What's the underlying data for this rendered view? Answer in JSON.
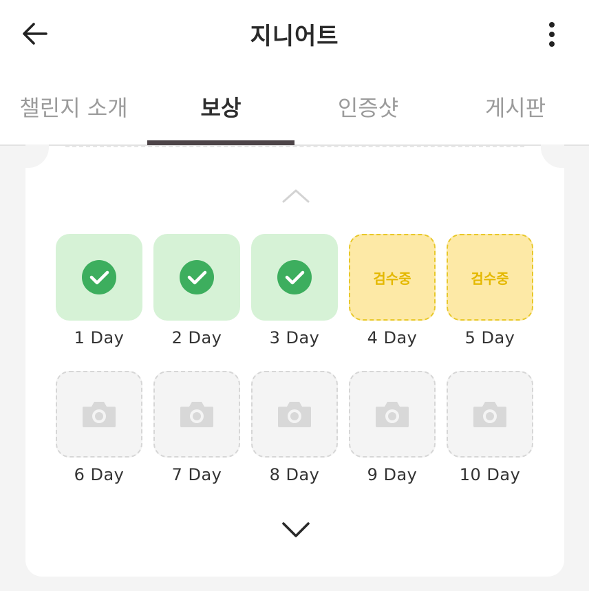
{
  "header": {
    "title": "지니어트",
    "back_icon": "arrow-left-icon",
    "more_icon": "more-vertical-icon"
  },
  "tabs": [
    {
      "label": "챌린지 소개",
      "active": false
    },
    {
      "label": "보상",
      "active": true
    },
    {
      "label": "인증샷",
      "active": false
    },
    {
      "label": "게시판",
      "active": false
    }
  ],
  "days": [
    {
      "label": "1 Day",
      "status": "done"
    },
    {
      "label": "2 Day",
      "status": "done"
    },
    {
      "label": "3 Day",
      "status": "done"
    },
    {
      "label": "4 Day",
      "status": "review",
      "status_text": "검수중"
    },
    {
      "label": "5 Day",
      "status": "review",
      "status_text": "검수중"
    },
    {
      "label": "6 Day",
      "status": "empty"
    },
    {
      "label": "7 Day",
      "status": "empty"
    },
    {
      "label": "8 Day",
      "status": "empty"
    },
    {
      "label": "9 Day",
      "status": "empty"
    },
    {
      "label": "10 Day",
      "status": "empty"
    }
  ],
  "colors": {
    "done_bg": "#d6f2d6",
    "check_green": "#3dae5e",
    "review_bg": "#fde9a6",
    "review_text": "#e4b800",
    "active_tab_indicator": "#4d4448"
  }
}
